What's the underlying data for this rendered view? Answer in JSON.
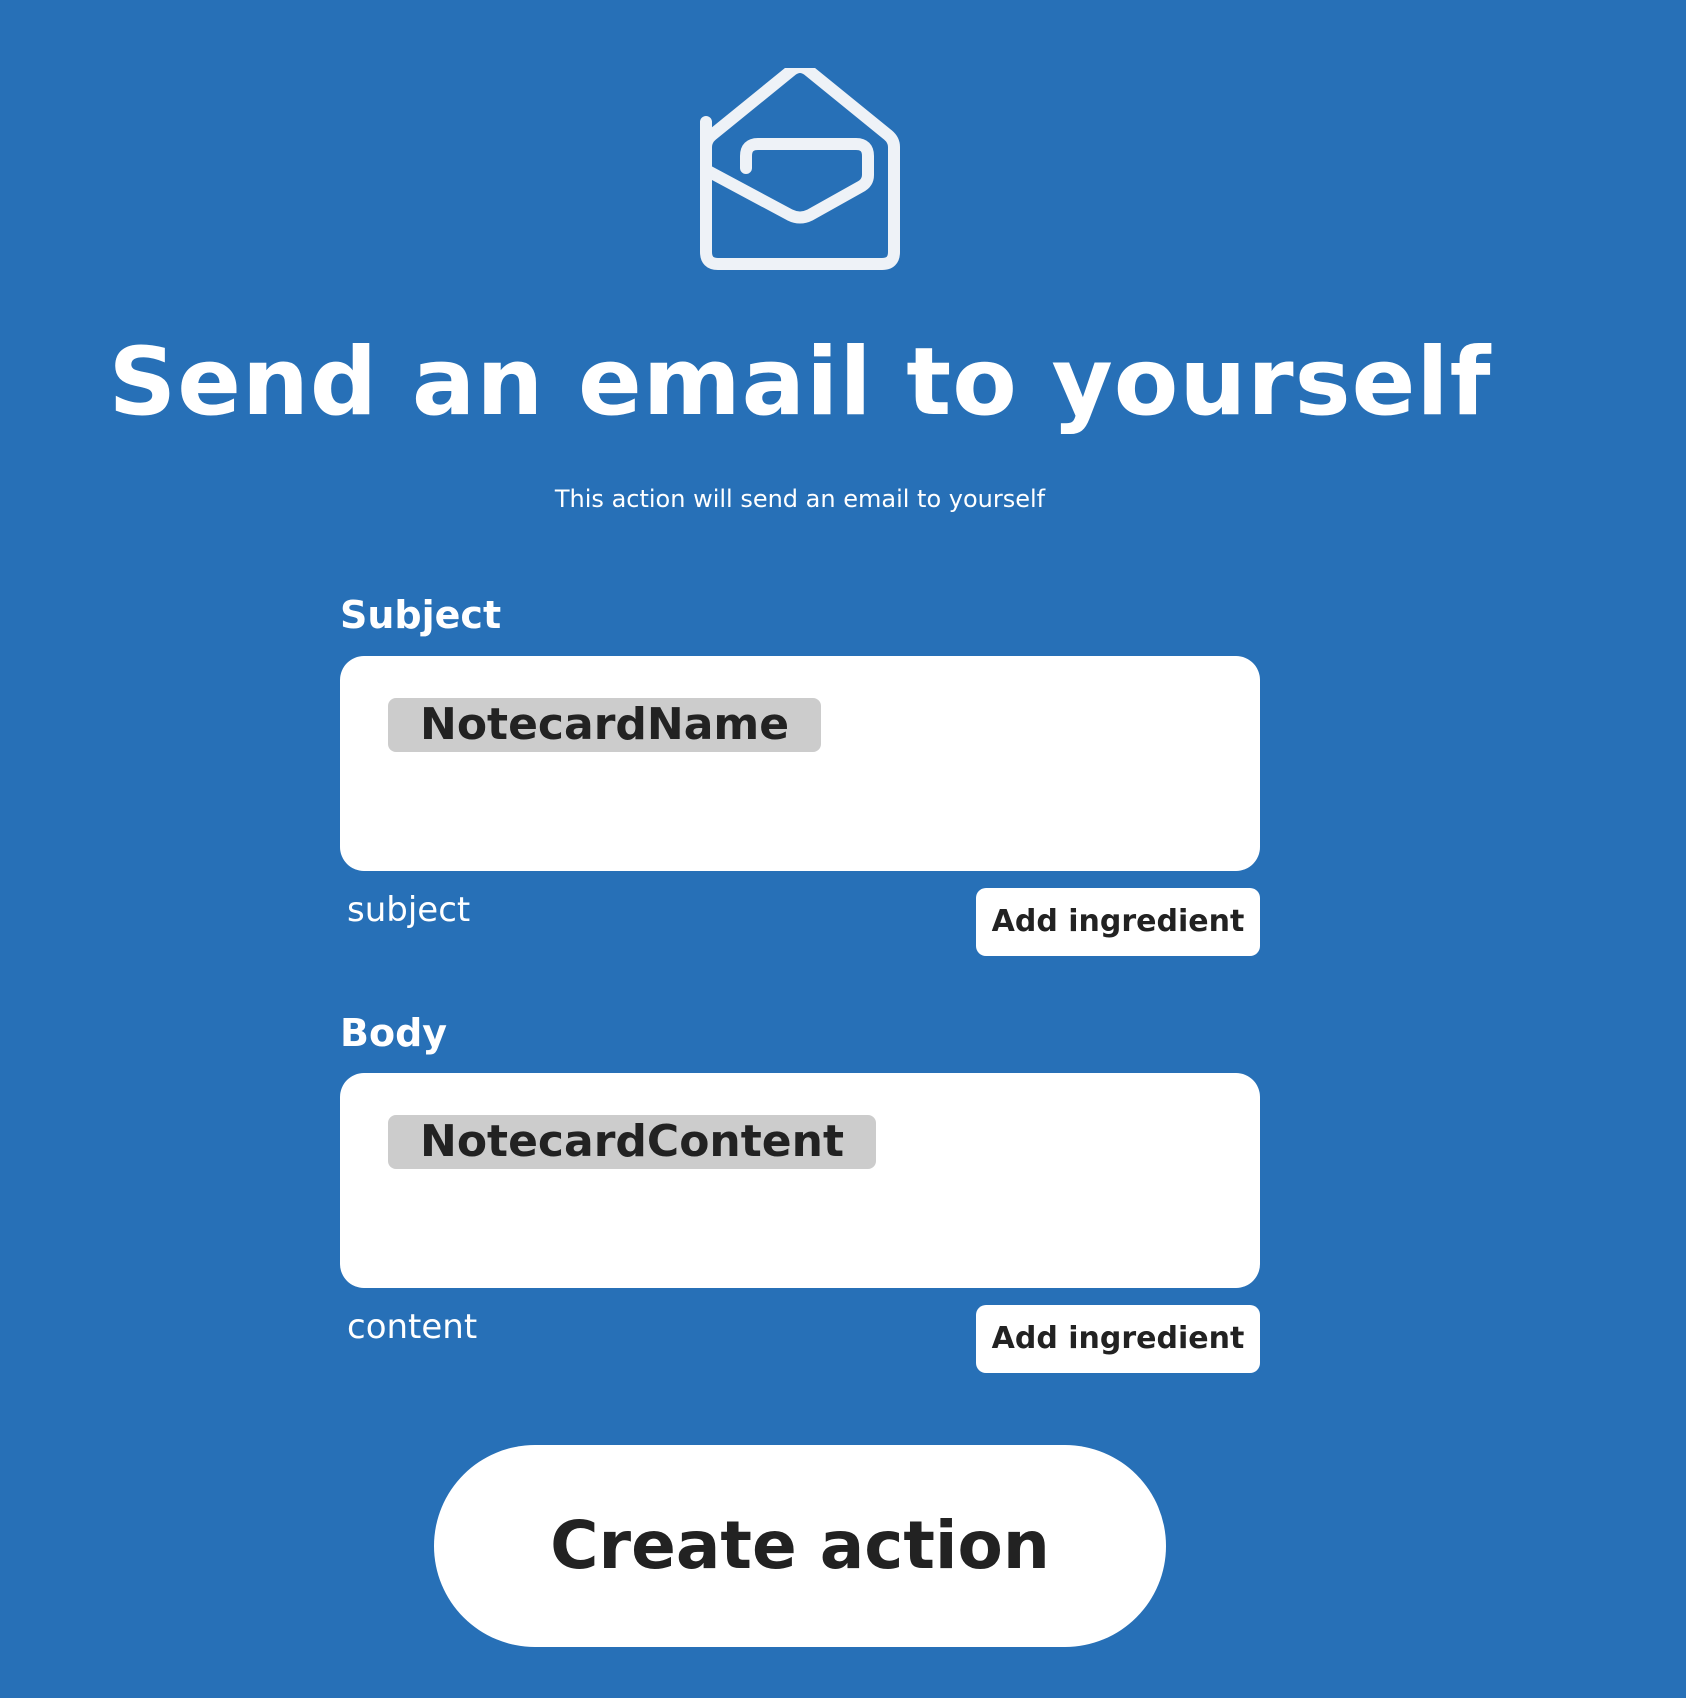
{
  "colors": {
    "background": "#2770b7",
    "foreground": "#ffffff",
    "field_background": "#ffffff",
    "ingredient_pill": "#cccccc",
    "dark_text": "#222222",
    "logo_stroke": "#eef2f7"
  },
  "header": {
    "icon": "email-envelope-icon",
    "title": "Send an email to yourself",
    "description": "This action will send an email to yourself"
  },
  "fields": [
    {
      "label": "Subject",
      "ingredient": "NotecardName",
      "helper": "subject",
      "add_ingredient_label": "Add ingredient"
    },
    {
      "label": "Body",
      "ingredient": "NotecardContent",
      "helper": "content",
      "add_ingredient_label": "Add ingredient"
    }
  ],
  "actions": {
    "create_label": "Create action"
  }
}
